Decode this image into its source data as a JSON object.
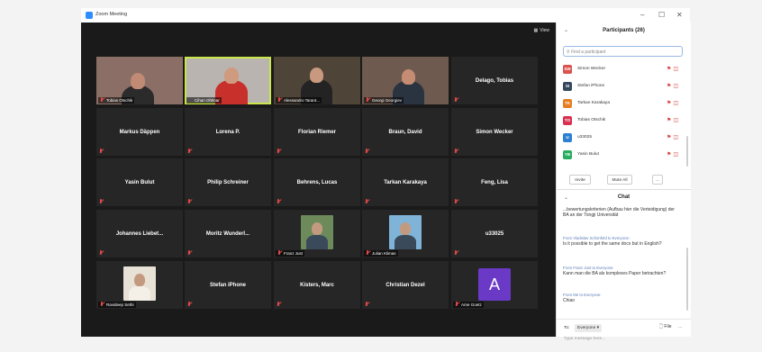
{
  "window": {
    "title": "Zoom Meeting",
    "minimize": "–",
    "maximize": "☐",
    "close": "✕"
  },
  "toolbar": {
    "view_label": "View",
    "view_icon": "grid-icon"
  },
  "grid": {
    "rows": [
      [
        {
          "name": "Tobias Otschik",
          "video": true,
          "muted": true,
          "label": true
        },
        {
          "name": "Cihan Ohlmar",
          "video": true,
          "muted": false,
          "label": true,
          "active": true
        },
        {
          "name": "Alessandro Tarant...",
          "video": true,
          "muted": true,
          "label": true
        },
        {
          "name": "Georgi Georgiev",
          "video": true,
          "muted": true,
          "label": true
        },
        {
          "name": "Delago, Tobias",
          "video": false,
          "muted": true,
          "label": false
        }
      ],
      [
        {
          "name": "Markus Däppen",
          "video": false,
          "muted": true
        },
        {
          "name": "Lorena P.",
          "video": false,
          "muted": true
        },
        {
          "name": "Florian Riemer",
          "video": false,
          "muted": true
        },
        {
          "name": "Braun, David",
          "video": false,
          "muted": true
        },
        {
          "name": "Simon Wecker",
          "video": false,
          "muted": true
        }
      ],
      [
        {
          "name": "Yasin Bulut",
          "video": false,
          "muted": true
        },
        {
          "name": "Philip Schreiner",
          "video": false,
          "muted": true
        },
        {
          "name": "Behrens, Lucas",
          "video": false,
          "muted": true
        },
        {
          "name": "Tarkan Karakaya",
          "video": false,
          "muted": true
        },
        {
          "name": "Feng, Lisa",
          "video": false,
          "muted": true
        }
      ],
      [
        {
          "name": "Johannes Liebet...",
          "video": false,
          "muted": true
        },
        {
          "name": "Moritz Wunderl...",
          "video": false,
          "muted": true
        },
        {
          "name": "Franz Just",
          "video": false,
          "muted": true,
          "photo": true
        },
        {
          "name": "Julian Klimas",
          "video": false,
          "muted": true,
          "photo": true
        },
        {
          "name": "u33025",
          "video": false,
          "muted": true
        }
      ],
      [
        {
          "name": "Ravideep Sethi",
          "video": false,
          "muted": true,
          "photo": true
        },
        {
          "name": "Stefan iPhone",
          "video": false,
          "muted": true
        },
        {
          "name": "Kisters, Marc",
          "video": false,
          "muted": true
        },
        {
          "name": "Christian Dezel",
          "video": false,
          "muted": true
        },
        {
          "name": "Arne Goetz",
          "video": false,
          "muted": true,
          "avatar_letter": "A"
        }
      ]
    ]
  },
  "participants": {
    "title": "Participants (26)",
    "search_placeholder": "Find a participant",
    "items": [
      {
        "initials": "SW",
        "name": "Simon Wecker",
        "color": "#d9534f"
      },
      {
        "initials": "SI",
        "name": "Stefan iPhone",
        "color": "#34495e"
      },
      {
        "initials": "TK",
        "name": "Tarkan Karakaya",
        "color": "#e67e22"
      },
      {
        "initials": "TO",
        "name": "Tobias Otschik",
        "color": "#d9304f"
      },
      {
        "initials": "U",
        "name": "u33025",
        "color": "#2d7fd3"
      },
      {
        "initials": "YB",
        "name": "Yasin Bulut",
        "color": "#27ae60"
      }
    ],
    "invite_label": "Invite",
    "mute_all_label": "Mute All",
    "more_label": "..."
  },
  "chat": {
    "title": "Chat",
    "messages": [
      {
        "from": "",
        "text": "...bewertungskriterien (Aufbau hier die Verteidigung) der BA an der Tongji Universität"
      },
      {
        "from": "From Vladislav Schönfeld to Everyone:",
        "text": "Is it possible to get the same docs but in English?"
      },
      {
        "from": "From Franz Just to Everyone:",
        "text": "Kann man die BA als komplexes Paper betrachten?"
      },
      {
        "from": "From Me to Everyone:",
        "text": "Chiao"
      }
    ],
    "to_label": "To:",
    "to_value": "Everyone ▾",
    "file_label": "File",
    "more_label": "...",
    "placeholder": "Type message here..."
  }
}
